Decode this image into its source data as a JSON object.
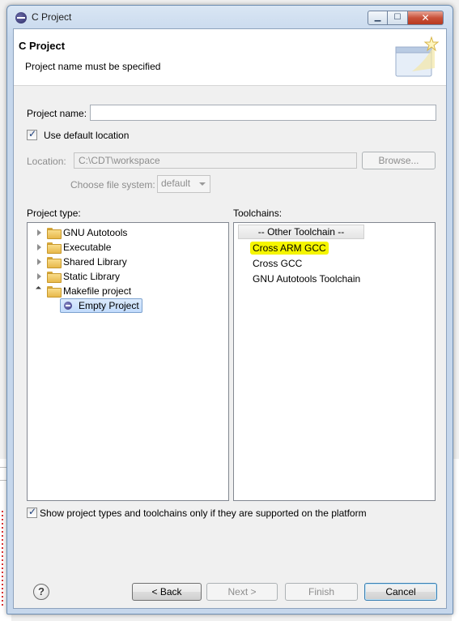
{
  "window": {
    "title": "C Project",
    "controls": [
      "minimize",
      "maximize",
      "close"
    ]
  },
  "header": {
    "title": "C Project",
    "message": "Project name must be specified"
  },
  "project_name": {
    "label": "Project name:",
    "value": ""
  },
  "use_default_location": {
    "label": "Use default location",
    "checked": true
  },
  "location": {
    "label": "Location:",
    "value": "C:\\CDT\\workspace",
    "browse_label": "Browse...",
    "enabled": false
  },
  "file_system": {
    "label": "Choose file system:",
    "value": "default",
    "enabled": false
  },
  "project_type": {
    "label": "Project type:",
    "items": [
      {
        "label": "GNU Autotools",
        "expanded": false
      },
      {
        "label": "Executable",
        "expanded": false
      },
      {
        "label": "Shared Library",
        "expanded": false
      },
      {
        "label": "Static Library",
        "expanded": false
      },
      {
        "label": "Makefile project",
        "expanded": true
      }
    ],
    "child": {
      "label": "Empty Project",
      "selected": true
    }
  },
  "toolchains": {
    "label": "Toolchains:",
    "header": "-- Other Toolchain --",
    "items": [
      {
        "label": "Cross ARM GCC",
        "highlighted": true
      },
      {
        "label": "Cross GCC",
        "highlighted": false
      },
      {
        "label": "GNU Autotools Toolchain",
        "highlighted": false
      }
    ],
    "highlight_color": "#f5f500"
  },
  "show_supported": {
    "label": "Show project types and toolchains only if they are supported on the platform",
    "checked": true
  },
  "buttons": {
    "help": "?",
    "back": "< Back",
    "next": "Next >",
    "finish": "Finish",
    "cancel": "Cancel"
  }
}
